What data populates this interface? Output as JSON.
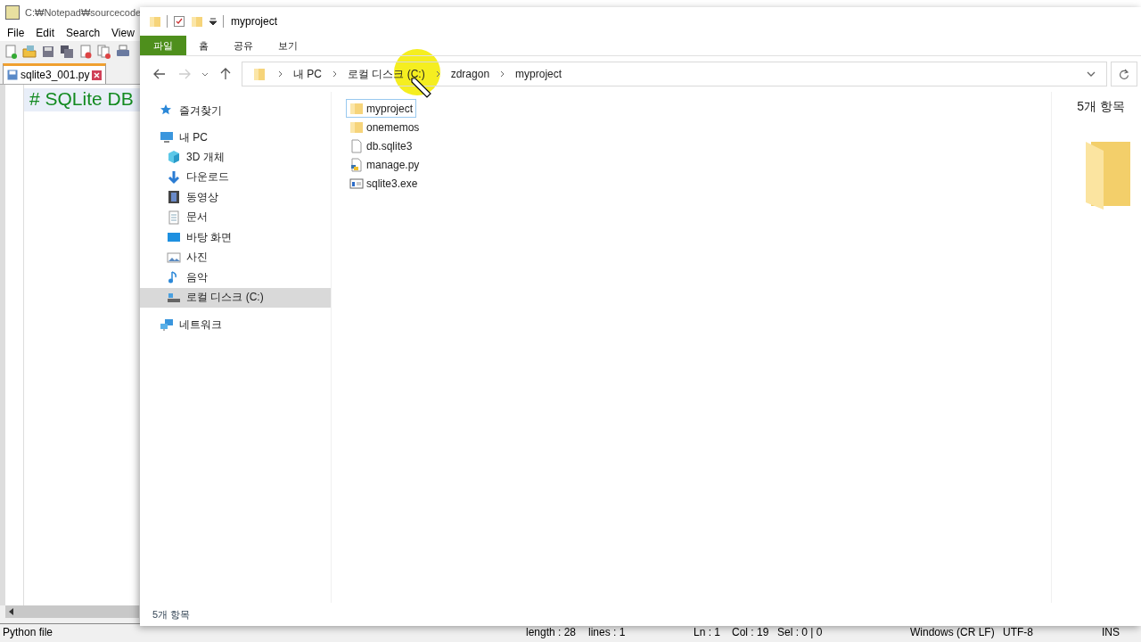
{
  "editor_window": {
    "title": "C:₩Notepad₩sourcecode",
    "menu": [
      "File",
      "Edit",
      "Search",
      "View"
    ],
    "tabs": [
      {
        "label": "sqlite3_001.py",
        "selected": true
      }
    ],
    "code_line": "# SQLite DB",
    "status_bar": [
      "Python file",
      "length : 28",
      "lines : 1",
      "Ln : 1",
      "Col : 19",
      "Sel : 0 | 0",
      "Windows (CR LF)",
      "UTF-8",
      "INS"
    ]
  },
  "explorer": {
    "title": "myproject",
    "ribbon_tabs": [
      {
        "label": "파일",
        "kind": "file"
      },
      {
        "label": "홈",
        "kind": "tab"
      },
      {
        "label": "공유",
        "kind": "tab"
      },
      {
        "label": "보기",
        "kind": "tab"
      }
    ],
    "breadcrumbs": [
      "내 PC",
      "로컬 디스크 (C:)",
      "zdragon",
      "myproject"
    ],
    "nav": [
      {
        "label": "즐겨찾기",
        "kind": "star",
        "selected": false
      },
      {
        "label": "내 PC",
        "kind": "pc",
        "selected": false,
        "children": [
          {
            "label": "3D 개체",
            "kind": "cube",
            "selected": false
          },
          {
            "label": "다운로드",
            "kind": "download",
            "selected": false
          },
          {
            "label": "동영상",
            "kind": "film",
            "selected": false
          },
          {
            "label": "문서",
            "kind": "doc",
            "selected": false
          },
          {
            "label": "바탕 화면",
            "kind": "desktop",
            "selected": false
          },
          {
            "label": "사진",
            "kind": "photo",
            "selected": false
          },
          {
            "label": "음악",
            "kind": "music",
            "selected": false
          },
          {
            "label": "로컬 디스크 (C:)",
            "kind": "drive",
            "selected": true
          }
        ]
      },
      {
        "label": "네트워크",
        "kind": "network",
        "selected": false
      }
    ],
    "files": [
      {
        "name": "myproject",
        "kind": "folder",
        "selected": true
      },
      {
        "name": "onememos",
        "kind": "folder",
        "selected": false
      },
      {
        "name": "db.sqlite3",
        "kind": "file",
        "selected": false
      },
      {
        "name": "manage.py",
        "kind": "python",
        "selected": false
      },
      {
        "name": "sqlite3.exe",
        "kind": "exe",
        "selected": false
      }
    ],
    "preview_count": "5개 항목",
    "status": "5개 항목"
  }
}
